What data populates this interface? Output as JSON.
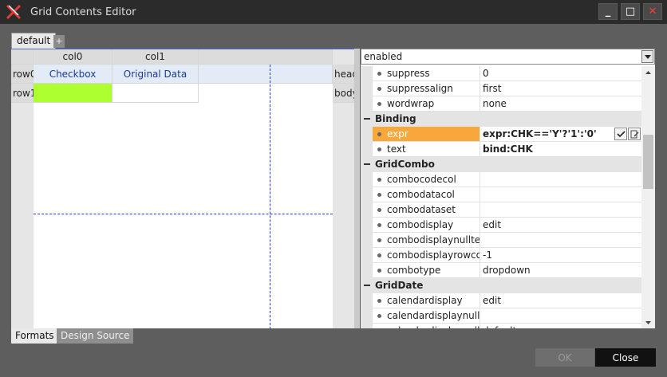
{
  "window": {
    "title": "Grid Contents Editor",
    "minimize_label": "_",
    "maximize_label": "□",
    "close_label": "✕"
  },
  "format_tabs": {
    "active": "default",
    "add_label": "+"
  },
  "grid": {
    "columns": [
      "col0",
      "col1"
    ],
    "rows": [
      "row0",
      "row1"
    ],
    "band_labels": [
      "head",
      "body"
    ],
    "head_cells": [
      "Checkbox",
      "Original Data"
    ],
    "body_cells": [
      "",
      ""
    ],
    "highlight_color": "#adff2f"
  },
  "bottom_tabs": [
    "Formats",
    "Design Source"
  ],
  "properties": {
    "filter_value": "enabled",
    "rows": [
      {
        "type": "prop",
        "name": "suppress",
        "value": "0"
      },
      {
        "type": "prop",
        "name": "suppressalign",
        "value": "first"
      },
      {
        "type": "prop",
        "name": "wordwrap",
        "value": "none"
      },
      {
        "type": "category",
        "name": "Binding"
      },
      {
        "type": "prop",
        "name": "expr",
        "value": "expr:CHK=='Y'?'1':'0'",
        "selected": true
      },
      {
        "type": "prop",
        "name": "text",
        "value": "bind:CHK",
        "bold": true
      },
      {
        "type": "category",
        "name": "GridCombo"
      },
      {
        "type": "prop",
        "name": "combocodecol",
        "value": ""
      },
      {
        "type": "prop",
        "name": "combodatacol",
        "value": ""
      },
      {
        "type": "prop",
        "name": "combodataset",
        "value": ""
      },
      {
        "type": "prop",
        "name": "combodisplay",
        "value": "edit"
      },
      {
        "type": "prop",
        "name": "combodisplaynulltext",
        "value": ""
      },
      {
        "type": "prop",
        "name": "combodisplayrowcount",
        "value": "-1"
      },
      {
        "type": "prop",
        "name": "combotype",
        "value": "dropdown"
      },
      {
        "type": "category",
        "name": "GridDate"
      },
      {
        "type": "prop",
        "name": "calendardisplay",
        "value": "edit"
      },
      {
        "type": "prop",
        "name": "calendardisplaynulltext",
        "value": ""
      },
      {
        "type": "prop",
        "name": "calendardisplaynulltype",
        "value": "default"
      }
    ]
  },
  "footer": {
    "ok_label": "OK",
    "close_label": "Close"
  },
  "colors": {
    "selected_row": "#f8a83a",
    "accent": "#4a6cd4"
  }
}
